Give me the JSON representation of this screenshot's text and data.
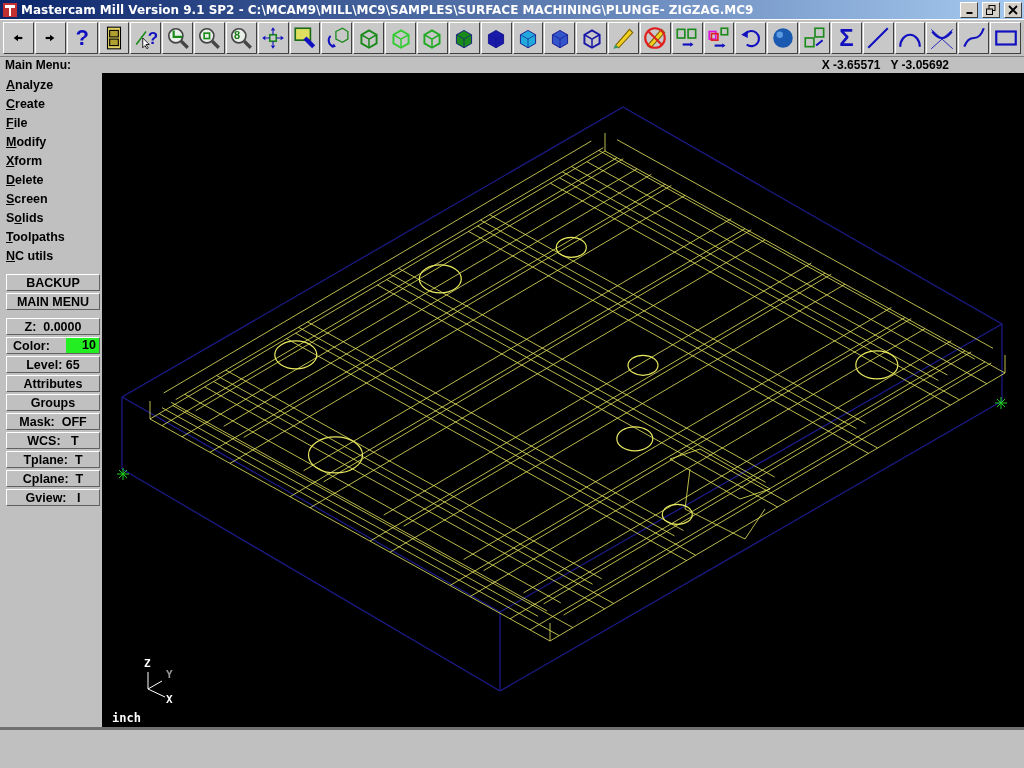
{
  "window": {
    "title": "Mastercam Mill Version 9.1 SP2 - C:\\MCAM9\\MILL\\MC9\\SAMPLES\\SURFACE MACHINING\\PLUNGE- ZIGZAG.MC9"
  },
  "toolbar": [
    {
      "kind": "arrow-left"
    },
    {
      "kind": "arrow-right"
    },
    {
      "kind": "help",
      "glyph": "?"
    },
    {
      "kind": "cabinet"
    },
    {
      "kind": "pointer-query",
      "glyph": "?"
    },
    {
      "kind": "zoom-window"
    },
    {
      "kind": "zoom"
    },
    {
      "kind": "zoom-glyph",
      "glyph": "8"
    },
    {
      "kind": "pan"
    },
    {
      "kind": "paint"
    },
    {
      "kind": "rotate"
    },
    {
      "kind": "cube",
      "color": "#1a8a1a"
    },
    {
      "kind": "cube",
      "color": "#33cc33"
    },
    {
      "kind": "cube",
      "color": "#22aa22"
    },
    {
      "kind": "cube-shaded",
      "color": "#1a8a1a"
    },
    {
      "kind": "cube-shaded",
      "color": "#1a1aaa"
    },
    {
      "kind": "cube-shaded",
      "color": "#22aadd"
    },
    {
      "kind": "cube-shaded",
      "color": "#3355cc"
    },
    {
      "kind": "cube",
      "color": "#1a1aaa"
    },
    {
      "kind": "pencil"
    },
    {
      "kind": "no-pencil"
    },
    {
      "kind": "move"
    },
    {
      "kind": "copy"
    },
    {
      "kind": "undo"
    },
    {
      "kind": "sphere"
    },
    {
      "kind": "cubes"
    },
    {
      "kind": "sigma",
      "glyph": "Σ"
    },
    {
      "kind": "line"
    },
    {
      "kind": "arc"
    },
    {
      "kind": "fillet"
    },
    {
      "kind": "spline"
    },
    {
      "kind": "rectangle"
    }
  ],
  "menu_bar": {
    "title": "Main Menu:",
    "x": "X -3.65571",
    "y": "Y -3.05692"
  },
  "main_menu": [
    {
      "hotkey": "A",
      "after": "nalyze"
    },
    {
      "hotkey": "C",
      "after": "reate"
    },
    {
      "hotkey": "F",
      "after": "ile"
    },
    {
      "hotkey": "M",
      "after": "odify"
    },
    {
      "hotkey": "X",
      "after": "form"
    },
    {
      "hotkey": "D",
      "after": "elete"
    },
    {
      "hotkey": "S",
      "after": "creen"
    },
    {
      "before": "S",
      "hotkey": "o",
      "after": "lids"
    },
    {
      "hotkey": "T",
      "after": "oolpaths"
    },
    {
      "hotkey": "N",
      "after": "C utils"
    }
  ],
  "nav_buttons": [
    "BACKUP",
    "MAIN MENU"
  ],
  "settings": [
    {
      "kind": "button",
      "label": "Z:  0.0000"
    },
    {
      "kind": "swatch",
      "label": "Color:",
      "value": "10",
      "color": "#22ee22"
    },
    {
      "kind": "button",
      "label": "Level: 65"
    },
    {
      "kind": "button",
      "label": "Attributes"
    },
    {
      "kind": "button",
      "label": "Groups"
    },
    {
      "kind": "button",
      "label": "Mask:  OFF"
    },
    {
      "kind": "button",
      "label": "WCS:   T"
    },
    {
      "kind": "button",
      "label": "Tplane:  T"
    },
    {
      "kind": "button",
      "label": "Cplane:  T"
    },
    {
      "kind": "button",
      "label": "Gview:   I"
    }
  ],
  "viewport": {
    "axes": {
      "z": "Z",
      "y": "Y",
      "x": "X"
    },
    "units": "inch"
  }
}
